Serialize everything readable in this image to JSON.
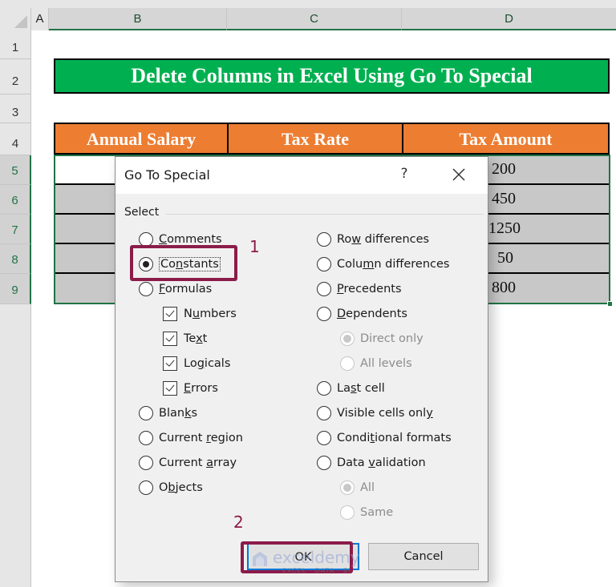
{
  "sheet": {
    "column_headers": [
      "A",
      "B",
      "C",
      "D"
    ],
    "row_headers": [
      "1",
      "2",
      "3",
      "4",
      "5",
      "6",
      "7",
      "8",
      "9"
    ],
    "title": "Delete Columns in Excel Using Go To Special",
    "table_headers": [
      "Annual Salary",
      "Tax Rate",
      "Tax Amount"
    ],
    "tax_amounts": [
      "200",
      "450",
      "1250",
      "50",
      "800"
    ],
    "colors": {
      "title_bg": "#00b050",
      "header_bg": "#ed7d31",
      "selection": "#217346"
    }
  },
  "dialog": {
    "title": "Go To Special",
    "help": "?",
    "group_label": "Select",
    "left_options": [
      {
        "pre": "",
        "key": "C",
        "post": "omments",
        "type": "radio",
        "checked": false
      },
      {
        "pre": "Co",
        "key": "n",
        "post": "stants",
        "type": "radio",
        "checked": true
      },
      {
        "pre": "",
        "key": "F",
        "post": "ormulas",
        "type": "radio",
        "checked": false
      },
      {
        "pre": "N",
        "key": "u",
        "post": "mbers",
        "type": "checkbox",
        "checked": true
      },
      {
        "pre": "Te",
        "key": "x",
        "post": "t",
        "type": "checkbox",
        "checked": true
      },
      {
        "pre": "Lo",
        "key": "g",
        "post": "icals",
        "type": "checkbox",
        "checked": true
      },
      {
        "pre": "",
        "key": "E",
        "post": "rrors",
        "type": "checkbox",
        "checked": true
      },
      {
        "pre": "Blan",
        "key": "k",
        "post": "s",
        "type": "radio",
        "checked": false
      },
      {
        "pre": "Current ",
        "key": "r",
        "post": "egion",
        "type": "radio",
        "checked": false
      },
      {
        "pre": "Current ",
        "key": "a",
        "post": "rray",
        "type": "radio",
        "checked": false
      },
      {
        "pre": "O",
        "key": "b",
        "post": "jects",
        "type": "radio",
        "checked": false
      }
    ],
    "right_options": [
      {
        "pre": "Ro",
        "key": "w",
        "post": " differences",
        "type": "radio",
        "checked": false,
        "disabled": false
      },
      {
        "pre": "Colu",
        "key": "m",
        "post": "n differences",
        "type": "radio",
        "checked": false,
        "disabled": false
      },
      {
        "pre": "",
        "key": "P",
        "post": "recedents",
        "type": "radio",
        "checked": false,
        "disabled": false
      },
      {
        "pre": "",
        "key": "D",
        "post": "ependents",
        "type": "radio",
        "checked": false,
        "disabled": false
      },
      {
        "pre": "Direct only",
        "key": "",
        "post": "",
        "type": "radio",
        "checked": true,
        "disabled": true
      },
      {
        "pre": "All levels",
        "key": "",
        "post": "",
        "type": "radio",
        "checked": false,
        "disabled": true
      },
      {
        "pre": "La",
        "key": "s",
        "post": "t cell",
        "type": "radio",
        "checked": false,
        "disabled": false
      },
      {
        "pre": "Visible cells onl",
        "key": "y",
        "post": "",
        "type": "radio",
        "checked": false,
        "disabled": false
      },
      {
        "pre": "Condi",
        "key": "t",
        "post": "ional formats",
        "type": "radio",
        "checked": false,
        "disabled": false
      },
      {
        "pre": "Data ",
        "key": "v",
        "post": "alidation",
        "type": "radio",
        "checked": false,
        "disabled": false
      },
      {
        "pre": "All",
        "key": "",
        "post": "",
        "type": "radio",
        "checked": true,
        "disabled": true
      },
      {
        "pre": "Same",
        "key": "",
        "post": "",
        "type": "radio",
        "checked": false,
        "disabled": true
      }
    ],
    "ok_label": "OK",
    "cancel_label": "Cancel"
  },
  "annotations": {
    "step1": "1",
    "step2": "2",
    "color": "#8b1c4a"
  },
  "watermark": {
    "brand": "exceldemy",
    "tagline": "EXCEL · DATA · BI"
  }
}
